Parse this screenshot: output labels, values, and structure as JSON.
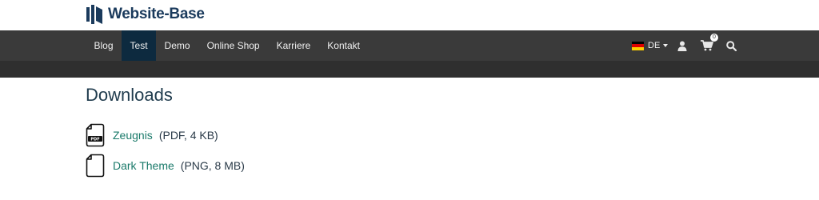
{
  "header": {
    "logo_text": "Website-Base",
    "colors": {
      "brand": "#1a3a5c",
      "accent": "#1a7a6a"
    }
  },
  "nav": {
    "items": [
      {
        "label": "Blog",
        "active": false
      },
      {
        "label": "Test",
        "active": true
      },
      {
        "label": "Demo",
        "active": false
      },
      {
        "label": "Online Shop",
        "active": false
      },
      {
        "label": "Karriere",
        "active": false
      },
      {
        "label": "Kontakt",
        "active": false
      }
    ],
    "language": "DE",
    "cart_count": "0",
    "icons": [
      "user-icon",
      "cart-icon",
      "search-icon"
    ]
  },
  "main": {
    "title": "Downloads",
    "downloads": [
      {
        "name": "Zeugnis",
        "meta": "(PDF, 4 KB)",
        "icon": "pdf-file-icon",
        "icon_label": "PDF"
      },
      {
        "name": "Dark Theme",
        "meta": "(PNG, 8 MB)",
        "icon": "file-icon"
      }
    ]
  }
}
